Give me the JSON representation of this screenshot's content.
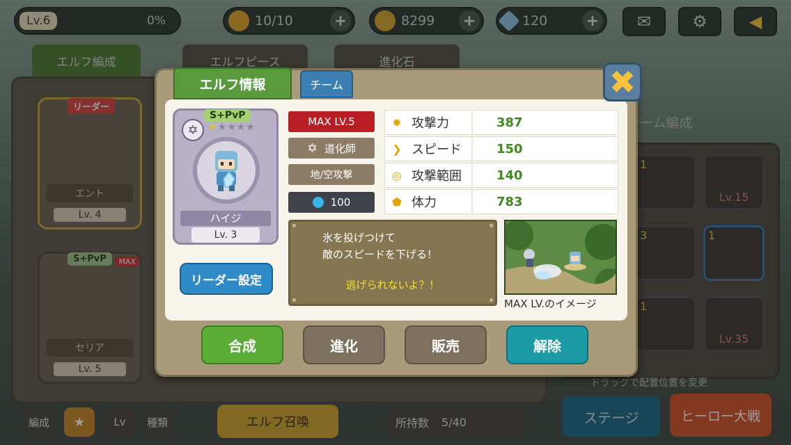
{
  "hud": {
    "level": "Lv.6",
    "exp_percent": "0%",
    "stamina": "10/10",
    "gold": "8299",
    "gems": "120"
  },
  "background": {
    "tabs": [
      "エルフ編成",
      "エルフピース",
      "進化石"
    ],
    "team_title": "チーム編成",
    "cards": [
      {
        "tag": "リーダー",
        "name": "エント",
        "level": "Lv. 4"
      },
      {
        "tag": "S+PvP",
        "name": "セリア",
        "level": "Lv. 5",
        "badge": "MAX"
      }
    ],
    "slots": [
      {
        "count": "1",
        "lock": ""
      },
      {
        "count": "",
        "lock": "Lv.15"
      },
      {
        "count": "3",
        "lock": ""
      },
      {
        "count": "1",
        "lock": ""
      },
      {
        "count": "1",
        "lock": ""
      },
      {
        "count": "",
        "lock": "Lv.35"
      }
    ],
    "drag_hint": "ドラッグで配置位置を変更",
    "filter_buttons": [
      "編成",
      "Lv",
      "種類"
    ],
    "summon_label": "エルフ召喚",
    "owned_label": "所持数",
    "owned_value": "5/40",
    "stage_button": "ステージ",
    "hero_battle_button": "ヒーロー大戦"
  },
  "dialog": {
    "tab_elf_info": "エルフ情報",
    "tab_team": "チーム",
    "character": {
      "rank": "S+PvP",
      "name": "ハイジ",
      "level": "Lv. 3",
      "stars_filled": 1,
      "stars_total": 5
    },
    "leader_button": "リーダー設定",
    "badges": {
      "max_level": "MAX LV.5",
      "class": "道化師",
      "attack_type": "地/空攻撃",
      "cost": "100"
    },
    "stats": [
      {
        "label": "攻撃力",
        "value": "387",
        "icon": "sun-icon"
      },
      {
        "label": "スピード",
        "value": "150",
        "icon": "chevron-right-icon"
      },
      {
        "label": "攻撃範囲",
        "value": "140",
        "icon": "target-icon"
      },
      {
        "label": "体力",
        "value": "783",
        "icon": "shield-icon"
      }
    ],
    "description": {
      "line1": "氷を投げつけて",
      "line2": "敵のスピードを下げる！",
      "quote": "逃げられないよ？！"
    },
    "preview_caption": "MAX LV.のイメージ",
    "actions": {
      "combine": "合成",
      "evolve": "進化",
      "sell": "販売",
      "release": "解除"
    }
  },
  "colors": {
    "green_button": "#5cad38",
    "teal_button": "#1c9aa6",
    "brown_button": "#7e705e",
    "max_badge": "#b81f25",
    "stat_value": "#3e8a1c"
  }
}
